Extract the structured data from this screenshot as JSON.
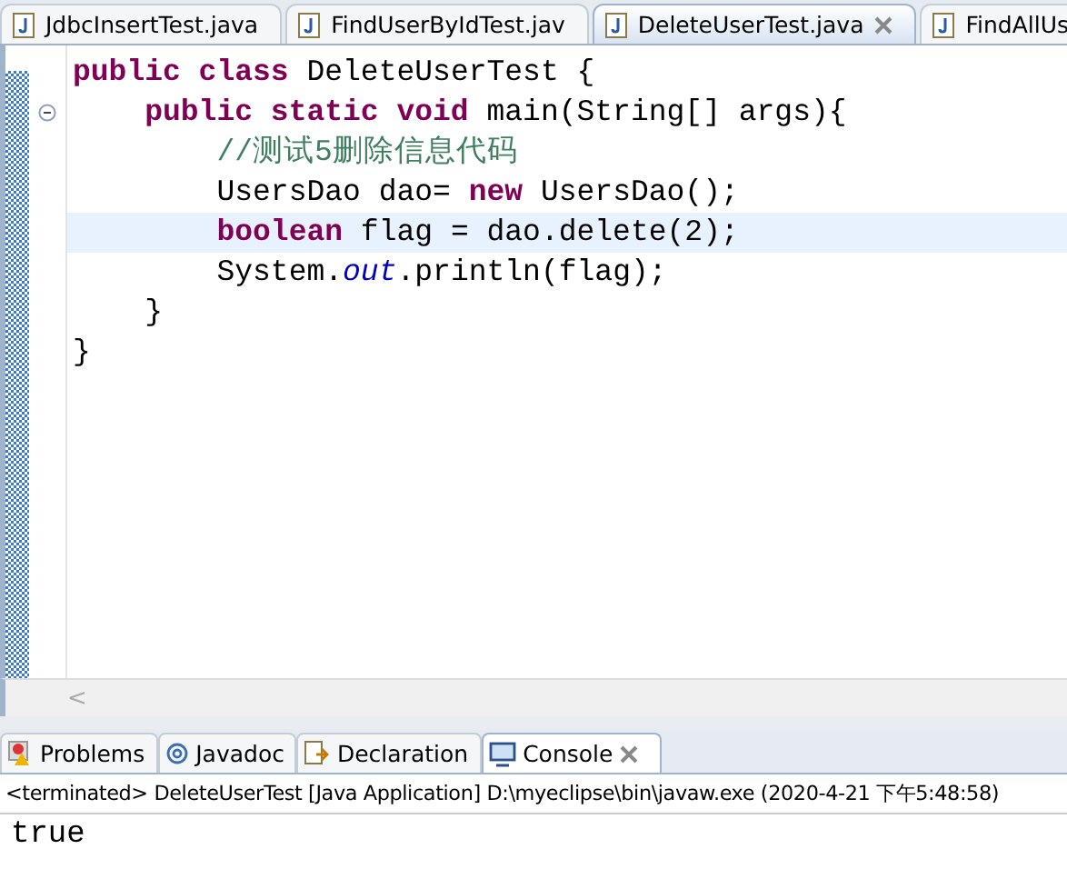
{
  "editor_tabs": [
    {
      "label": "JdbcInsertTest.java",
      "selected": false,
      "closable": false
    },
    {
      "label": "FindUserByIdTest.jav",
      "selected": false,
      "closable": false
    },
    {
      "label": "DeleteUserTest.java",
      "selected": true,
      "closable": true
    },
    {
      "label": "FindAllUs",
      "selected": false,
      "closable": false
    }
  ],
  "code_lines": [
    {
      "selected": false,
      "foldable": false,
      "tokens": [
        {
          "kind": "keyword",
          "text": "public class"
        },
        {
          "kind": "plain",
          "text": " DeleteUserTest {"
        }
      ]
    },
    {
      "selected": false,
      "foldable": true,
      "tokens": [
        {
          "kind": "keyword",
          "text": "    public static void"
        },
        {
          "kind": "plain",
          "text": " main(String[] args){"
        }
      ]
    },
    {
      "selected": false,
      "foldable": false,
      "tokens": [
        {
          "kind": "comment",
          "text": "        //测试5删除信息代码"
        }
      ]
    },
    {
      "selected": false,
      "foldable": false,
      "tokens": [
        {
          "kind": "plain",
          "text": "        UsersDao dao= "
        },
        {
          "kind": "keyword",
          "text": "new"
        },
        {
          "kind": "plain",
          "text": " UsersDao();"
        }
      ]
    },
    {
      "selected": true,
      "foldable": false,
      "tokens": [
        {
          "kind": "keyword",
          "text": "        boolean"
        },
        {
          "kind": "plain",
          "text": " flag = dao.delete(2);"
        }
      ]
    },
    {
      "selected": false,
      "foldable": false,
      "tokens": [
        {
          "kind": "plain",
          "text": "        System."
        },
        {
          "kind": "field",
          "text": "out"
        },
        {
          "kind": "plain",
          "text": ".println(flag);"
        }
      ]
    },
    {
      "selected": false,
      "foldable": false,
      "tokens": [
        {
          "kind": "plain",
          "text": "    }"
        }
      ]
    },
    {
      "selected": false,
      "foldable": false,
      "tokens": [
        {
          "kind": "plain",
          "text": "}"
        }
      ]
    }
  ],
  "scroll_left": "<",
  "panel_tabs": [
    {
      "label": "Problems",
      "kind": "problems",
      "selected": false,
      "closable": false
    },
    {
      "label": "Javadoc",
      "kind": "javadoc",
      "selected": false,
      "closable": false
    },
    {
      "label": "Declaration",
      "kind": "declaration",
      "selected": false,
      "closable": false
    },
    {
      "label": "Console",
      "kind": "console",
      "selected": true,
      "closable": true
    }
  ],
  "console": {
    "status": "<terminated> DeleteUserTest [Java Application] D:\\myeclipse\\bin\\javaw.exe (2020-4-21 下午5:48:58)",
    "output": "true"
  }
}
